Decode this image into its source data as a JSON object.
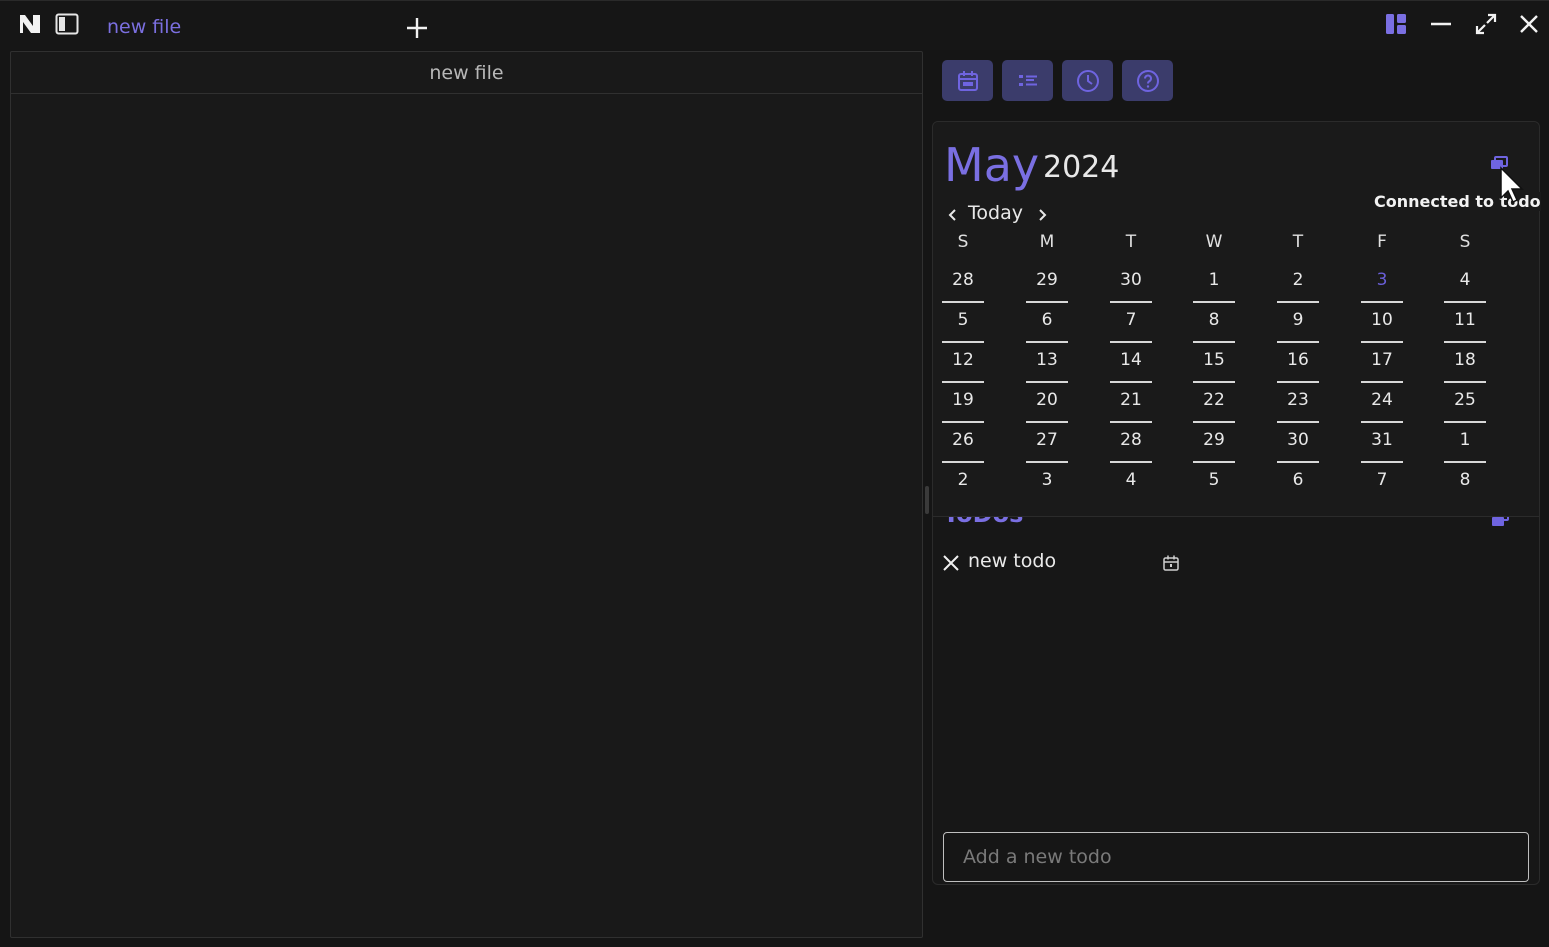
{
  "titlebar": {
    "tab_title": "new file",
    "icons": [
      "logo-icon",
      "sidebar-toggle-icon",
      "plus-icon",
      "layout-icon",
      "minimize-icon",
      "maximize-icon",
      "close-icon"
    ]
  },
  "editor": {
    "title": "new file"
  },
  "toolbar": {
    "buttons": [
      "calendar-icon",
      "checklist-icon",
      "clock-icon",
      "help-icon"
    ],
    "accent": "#7a6fe2",
    "button_bg": "#3b3c6b"
  },
  "calendar": {
    "month": "May",
    "year": "2024",
    "today_label": "Today",
    "tooltip": "Connected to todo",
    "weekdays": [
      "S",
      "M",
      "T",
      "W",
      "T",
      "F",
      "S"
    ],
    "weeks": [
      [
        "28",
        "29",
        "30",
        "1",
        "2",
        "3",
        "4"
      ],
      [
        "5",
        "6",
        "7",
        "8",
        "9",
        "10",
        "11"
      ],
      [
        "12",
        "13",
        "14",
        "15",
        "16",
        "17",
        "18"
      ],
      [
        "19",
        "20",
        "21",
        "22",
        "23",
        "24",
        "25"
      ],
      [
        "26",
        "27",
        "28",
        "29",
        "30",
        "31",
        "1"
      ],
      [
        "2",
        "3",
        "4",
        "5",
        "6",
        "7",
        "8"
      ]
    ],
    "selected_day": "3"
  },
  "todos": {
    "title": "ToDos",
    "items": [
      {
        "text": "new todo"
      }
    ],
    "input_placeholder": "Add a new todo"
  }
}
